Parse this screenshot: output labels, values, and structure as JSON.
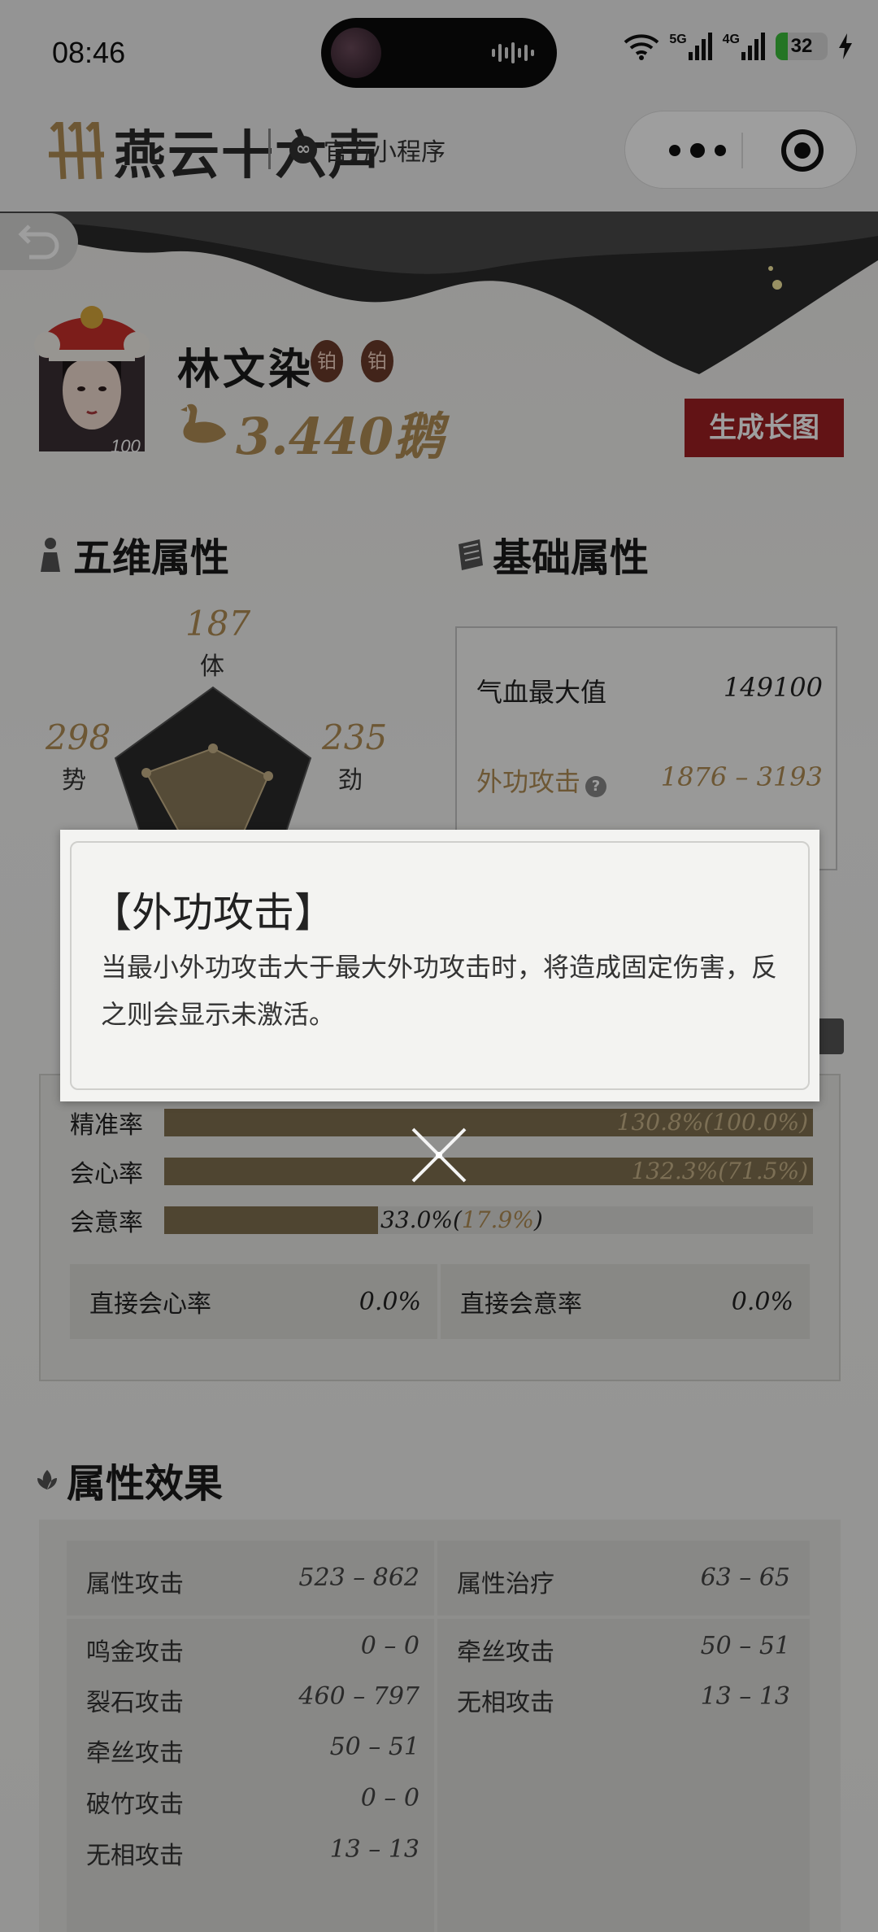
{
  "status_bar": {
    "time": "08:46",
    "signal_5g": "5G",
    "signal_4g": "4G",
    "battery": "32"
  },
  "header": {
    "logo_text": "燕云十六声",
    "official_label": "官方小程序"
  },
  "profile": {
    "name": "林文染",
    "badge_1": "铂",
    "badge_2": "铂",
    "level": "100",
    "goose_value": "3.440鹅",
    "generate_button": "生成长图"
  },
  "five_dim": {
    "title": "五维属性",
    "stats": [
      {
        "label": "体",
        "value": "187"
      },
      {
        "label": "势",
        "value": "298"
      },
      {
        "label": "劲",
        "value": "235"
      }
    ]
  },
  "basic": {
    "title": "基础属性",
    "rows": [
      {
        "label": "气血最大值",
        "value": "149100"
      },
      {
        "label": "外功攻击",
        "value": "1876 – 3193"
      }
    ]
  },
  "combat": {
    "bars": [
      {
        "label": "精准率",
        "text": "130.8%(100.0%)",
        "fill": 1.0
      },
      {
        "label": "会心率",
        "text": "132.3%(71.5%)",
        "fill": 1.0
      },
      {
        "label": "会意率",
        "text_main": "33.0%(",
        "text_sub": "17.9%",
        "text_end": ")",
        "fill": 0.33
      }
    ],
    "cells": [
      {
        "label": "直接会心率",
        "value": "0.0%"
      },
      {
        "label": "直接会意率",
        "value": "0.0%"
      }
    ]
  },
  "effects": {
    "title": "属性效果",
    "left_header": {
      "label": "属性攻击",
      "value": "523 – 862"
    },
    "right_header": {
      "label": "属性治疗",
      "value": "63 – 65"
    },
    "left_rows": [
      {
        "label": "鸣金攻击",
        "value": "0 – 0"
      },
      {
        "label": "裂石攻击",
        "value": "460 – 797"
      },
      {
        "label": "牵丝攻击",
        "value": "50 – 51"
      },
      {
        "label": "破竹攻击",
        "value": "0 – 0"
      },
      {
        "label": "无相攻击",
        "value": "13 – 13"
      }
    ],
    "right_rows": [
      {
        "label": "牵丝攻击",
        "value": "50 – 51"
      },
      {
        "label": "无相攻击",
        "value": "13 – 13"
      }
    ]
  },
  "modal": {
    "title": "【外功攻击】",
    "body": "当最小外功攻击大于最大外功攻击时，将造成固定伤害，反之则会显示未激活。"
  },
  "colors": {
    "accent_gold": "#b08d55",
    "button_red": "#9e1f22",
    "bar_fill": "#80704f"
  }
}
